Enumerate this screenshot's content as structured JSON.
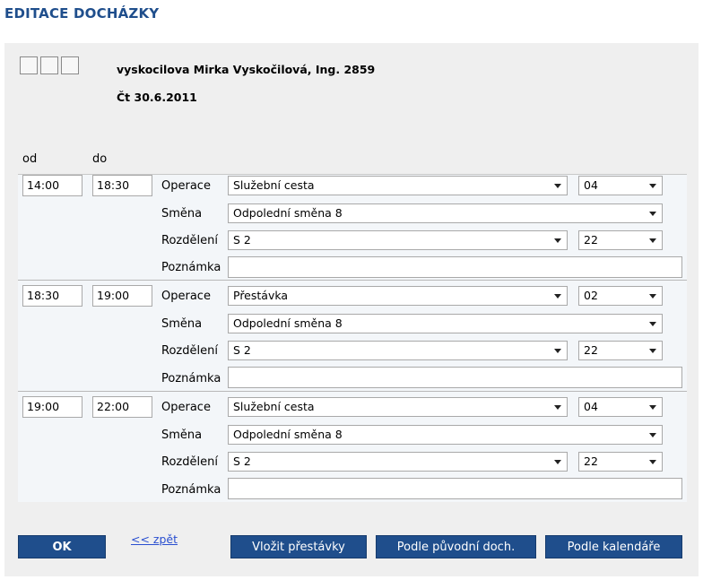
{
  "page": {
    "title": "EDITACE DOCHÁZKY"
  },
  "header": {
    "user": "vyskocilova Mirka Vyskočilová, Ing. 2859",
    "date": "Čt 30.6.2011"
  },
  "columns": {
    "from": "od",
    "to": "do"
  },
  "labels": {
    "operation": "Operace",
    "shift": "Směna",
    "split": "Rozdělení",
    "note": "Poznámka"
  },
  "records": [
    {
      "from": "14:00",
      "to": "18:30",
      "operation": "Služební cesta",
      "operation_code": "04",
      "shift": "Odpolední směna 8",
      "split": "S 2",
      "split_code": "22",
      "note": ""
    },
    {
      "from": "18:30",
      "to": "19:00",
      "operation": "Přestávka",
      "operation_code": "02",
      "shift": "Odpolední směna 8",
      "split": "S 2",
      "split_code": "22",
      "note": ""
    },
    {
      "from": "19:00",
      "to": "22:00",
      "operation": "Služební cesta",
      "operation_code": "04",
      "shift": "Odpolední směna 8",
      "split": "S 2",
      "split_code": "22",
      "note": ""
    }
  ],
  "actions": {
    "ok": "OK",
    "back": "<< zpět",
    "insert_breaks": "Vložit přestávky",
    "by_original": "Podle původní doch.",
    "by_calendar": "Podle kalendáře"
  },
  "colors": {
    "accent": "#1f4e8c",
    "panel": "#efefef",
    "link": "#2a4fd0"
  }
}
